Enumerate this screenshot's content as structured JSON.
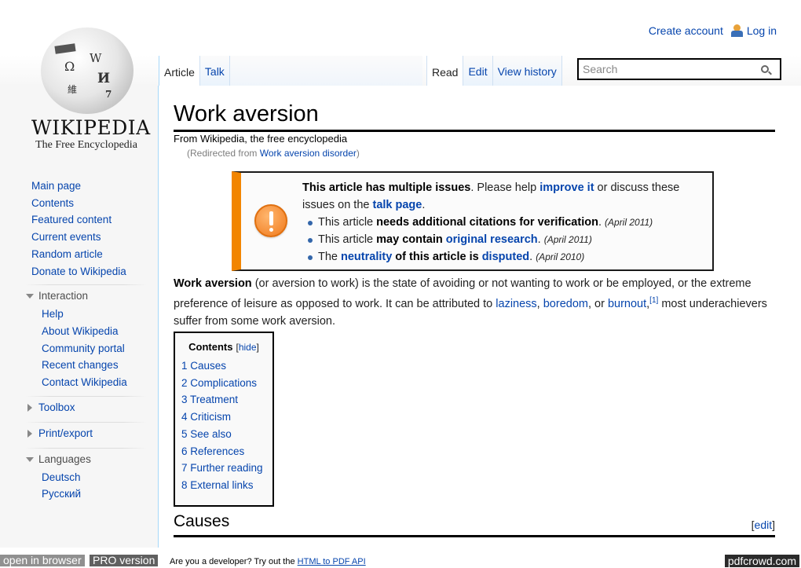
{
  "personal": {
    "create_account": "Create account",
    "log_in": "Log in"
  },
  "logo": {
    "wordmark": "WIKIPEDIA",
    "tagline": "The Free Encyclopedia",
    "globe_glyphs": [
      "Ω",
      "W",
      "И",
      "維",
      "7"
    ]
  },
  "tabs": {
    "left": [
      {
        "label": "Article",
        "selected": true
      },
      {
        "label": "Talk",
        "selected": false
      }
    ],
    "right": [
      {
        "label": "Read",
        "selected": true
      },
      {
        "label": "Edit",
        "selected": false
      },
      {
        "label": "View history",
        "selected": false
      }
    ]
  },
  "search": {
    "placeholder": "Search",
    "value": ""
  },
  "article": {
    "title": "Work aversion",
    "site_sub": "From Wikipedia, the free encyclopedia",
    "redirect_prefix": "(Redirected from ",
    "redirect_link": "Work aversion disorder",
    "redirect_suffix": ")"
  },
  "ambox": {
    "accent_color": "#f28500",
    "intro_bold": "This article has multiple issues",
    "intro_text1": ". Please help ",
    "improve_link": "improve it",
    "intro_text2": " or discuss these issues on the ",
    "talk_link": "talk page",
    "intro_text3": ".",
    "issues": [
      {
        "pre": "This article ",
        "bold": "needs additional citations for verification",
        "post": ". ",
        "date": "(April 2011)"
      },
      {
        "pre": "This article ",
        "bold": "may contain ",
        "link": "original research",
        "post": ". ",
        "date": "(April 2011)"
      },
      {
        "pre": "The ",
        "link1": "neutrality",
        "bold": " of this article is ",
        "link2": "disputed",
        "post": ". ",
        "date": "(April 2010)"
      }
    ]
  },
  "lead": {
    "bold": "Work aversion",
    "text1": " (or aversion to work) is the state of avoiding or not wanting to work or be employed, or the extreme preference of leisure as opposed to work. It can be attributed to ",
    "link1": "laziness",
    "sep1": ", ",
    "link2": "boredom",
    "sep2": ", or ",
    "link3": "burnout",
    "sep3": ",",
    "ref": "[1]",
    "text2": " most underachievers suffer from some work aversion."
  },
  "toc": {
    "title": "Contents",
    "hide_open": "[",
    "hide_label": "hide",
    "hide_close": "]",
    "items": [
      "1 Causes",
      "2 Complications",
      "3 Treatment",
      "4 Criticism",
      "5 See also",
      "6 References",
      "7 Further reading",
      "8 External links"
    ]
  },
  "sections": {
    "causes": "Causes",
    "edit_open": "[",
    "edit_label": "edit",
    "edit_close": "]"
  },
  "sidebar": {
    "navigation": [
      "Main page",
      "Contents",
      "Featured content",
      "Current events",
      "Random article",
      "Donate to Wikipedia"
    ],
    "interaction": {
      "heading": "Interaction",
      "items": [
        "Help",
        "About Wikipedia",
        "Community portal",
        "Recent changes",
        "Contact Wikipedia"
      ]
    },
    "toolbox": "Toolbox",
    "print_export": "Print/export",
    "languages": {
      "heading": "Languages",
      "items": [
        "Deutsch",
        "Русский"
      ]
    }
  },
  "pdfcrowd": {
    "open_in_browser": "open in browser",
    "pro_version": "PRO version",
    "dev_text": "Are you a developer? Try out the ",
    "api_link": "HTML to PDF API",
    "brand": "pdfcrowd.com"
  }
}
